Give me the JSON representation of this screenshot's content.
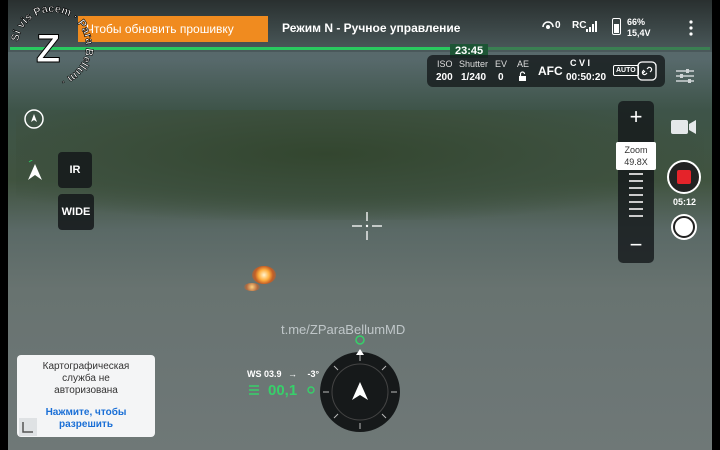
{
  "app": {
    "notice": "Чтобы обновить прошивку",
    "mode": "Режим N - Ручное управление",
    "status": {
      "signal_count": "0",
      "rc_label": "RC",
      "battery_percent": "66%",
      "battery_voltage": "15,4V"
    },
    "flight_time": "23:45"
  },
  "logo": {
    "letter": "Z",
    "text": "Si vis Pacem Para Bellum"
  },
  "camera": {
    "iso_label": "ISO",
    "iso_value": "200",
    "shutter_label": "Shutter",
    "shutter_value": "1/240",
    "ev_label": "EV",
    "ev_value": "0",
    "ae_label": "AE",
    "focus_mode": "AFC",
    "storage": "C V I",
    "remaining_time": "00:50:20",
    "auto_label": "AUTO"
  },
  "left_controls": {
    "ir_label": "IR",
    "wide_label": "WIDE"
  },
  "zoom": {
    "plus": "+",
    "minus": "−",
    "label": "Zoom",
    "value": "49.8X"
  },
  "record": {
    "timer": "05:12"
  },
  "watermark": "t.me/ZParaBellumMD",
  "map_card": {
    "message": "Картографическая служба не авторизована",
    "action": "Нажмите, чтобы разрешить"
  },
  "telemetry": {
    "ws": "WS 03.9",
    "angle": "-3°",
    "altitude": "00,1"
  },
  "colors": {
    "accent": "#f08b1f",
    "green": "#29c95f",
    "record": "#e5232a",
    "link": "#1a6fd6"
  }
}
